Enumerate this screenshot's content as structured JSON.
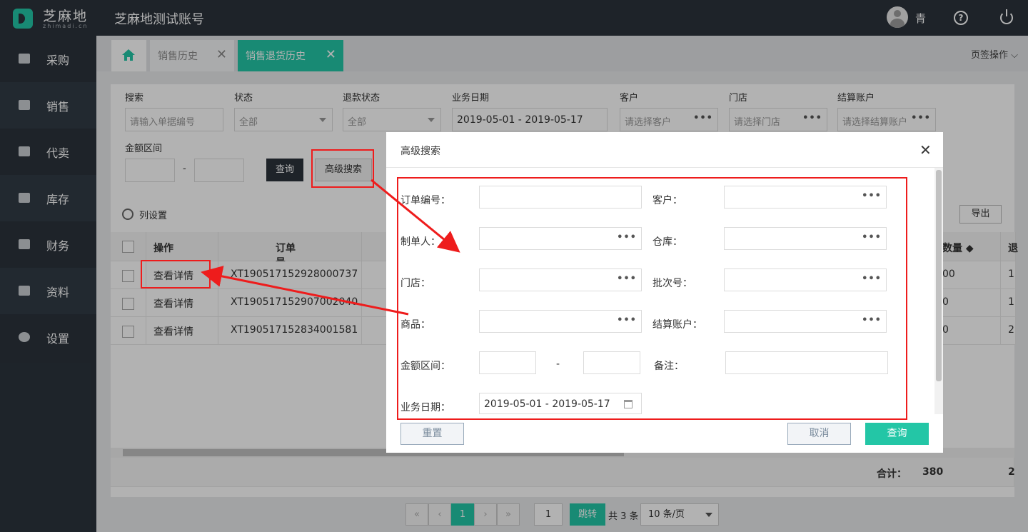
{
  "header": {
    "logo": "芝麻地",
    "logo_sub": "zhimadi.cn",
    "account": "芝麻地测试账号",
    "user": "青",
    "help": "?"
  },
  "sidebar": {
    "items": [
      {
        "label": "采购",
        "icon": "cart-icon"
      },
      {
        "label": "销售",
        "icon": "sale-icon"
      },
      {
        "label": "代卖",
        "icon": "consign-icon"
      },
      {
        "label": "库存",
        "icon": "warehouse-icon"
      },
      {
        "label": "财务",
        "icon": "finance-icon"
      },
      {
        "label": "资料",
        "icon": "data-icon"
      },
      {
        "label": "设置",
        "icon": "gear-icon"
      }
    ]
  },
  "tabs": {
    "items": [
      {
        "label": "销售历史"
      },
      {
        "label": "销售退货历史"
      }
    ],
    "close": "✕",
    "ops_label": "页签操作"
  },
  "filters": {
    "search": {
      "label": "搜索",
      "placeholder": "请输入单据编号"
    },
    "status": {
      "label": "状态",
      "value": "全部"
    },
    "refund_status": {
      "label": "退款状态",
      "value": "全部"
    },
    "biz_date": {
      "label": "业务日期",
      "value": "2019-05-01 - 2019-05-17"
    },
    "customer": {
      "label": "客户",
      "placeholder": "请选择客户"
    },
    "store": {
      "label": "门店",
      "placeholder": "请选择门店"
    },
    "account": {
      "label": "结算账户",
      "placeholder": "请选择结算账户"
    },
    "amount_label": "金额区间",
    "dash": "-",
    "query_btn": "查询",
    "advanced_btn": "高级搜索",
    "dots": "•••"
  },
  "toolbar": {
    "column_settings": "列设置",
    "export": "导出"
  },
  "table": {
    "headers": {
      "op": "操作",
      "order": "订单号",
      "qty": "数量 ◆",
      "last": "退"
    },
    "rows": [
      {
        "op": "查看详情",
        "order": "XT190517152928000737",
        "qty": "00",
        "last": "1"
      },
      {
        "op": "查看详情",
        "order": "XT190517152907002040",
        "qty": "0",
        "last": "1"
      },
      {
        "op": "查看详情",
        "order": "XT190517152834001581",
        "qty": "0",
        "last": "2"
      }
    ],
    "footer": {
      "total_label": "合计：",
      "total_qty": "380",
      "last": "2"
    }
  },
  "pager": {
    "first": "«",
    "prev": "‹",
    "current": "1",
    "next": "›",
    "last": "»",
    "goto": "1",
    "jump": "跳转",
    "total": "共 3 条",
    "page_size": "10 条/页"
  },
  "modal": {
    "title": "高级搜索",
    "close": "✕",
    "order_no": "订单编号：",
    "customer": "客户：",
    "maker": "制单人：",
    "warehouse": "仓库：",
    "store": "门店：",
    "batch": "批次号：",
    "product": "商品：",
    "account": "结算账户：",
    "amount": "金额区间：",
    "remark": "备注：",
    "biz_date": "业务日期：",
    "date_value": "2019-05-01 - 2019-05-17",
    "dash": "-",
    "dots": "•••",
    "reset": "重置",
    "cancel": "取消",
    "query": "查询"
  }
}
